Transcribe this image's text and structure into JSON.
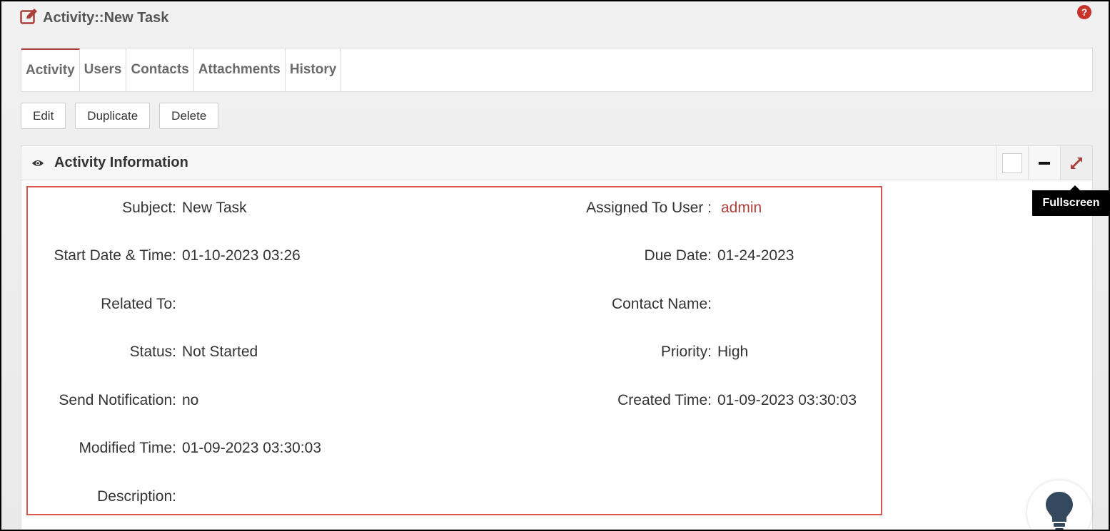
{
  "header": {
    "title": "Activity::New Task",
    "help_icon": "question-circle-icon"
  },
  "tabs": [
    {
      "label": "Activity",
      "active": true
    },
    {
      "label": "Users"
    },
    {
      "label": "Contacts"
    },
    {
      "label": "Attachments"
    },
    {
      "label": "History"
    }
  ],
  "actions": {
    "edit": "Edit",
    "duplicate": "Duplicate",
    "delete": "Delete"
  },
  "panel": {
    "title": "Activity Information",
    "tooltip": "Fullscreen"
  },
  "fields": {
    "subject": {
      "label": "Subject:",
      "value": "New Task"
    },
    "assigned_to": {
      "label": "Assigned To User :",
      "value": "admin"
    },
    "start_date": {
      "label": "Start Date & Time:",
      "value": "01-10-2023 03:26"
    },
    "due_date": {
      "label": "Due Date:",
      "value": "01-24-2023"
    },
    "related_to": {
      "label": "Related To:",
      "value": ""
    },
    "contact_name": {
      "label": "Contact Name:",
      "value": ""
    },
    "status": {
      "label": "Status:",
      "value": "Not Started"
    },
    "priority": {
      "label": "Priority:",
      "value": "High"
    },
    "send_notification": {
      "label": "Send Notification:",
      "value": "no"
    },
    "created_time": {
      "label": "Created Time:",
      "value": "01-09-2023 03:30:03"
    },
    "modified_time": {
      "label": "Modified Time:",
      "value": "01-09-2023 03:30:03"
    },
    "description": {
      "label": "Description:",
      "value": ""
    }
  },
  "colors": {
    "accent": "#a8413b",
    "highlight_border": "#d9534f"
  }
}
